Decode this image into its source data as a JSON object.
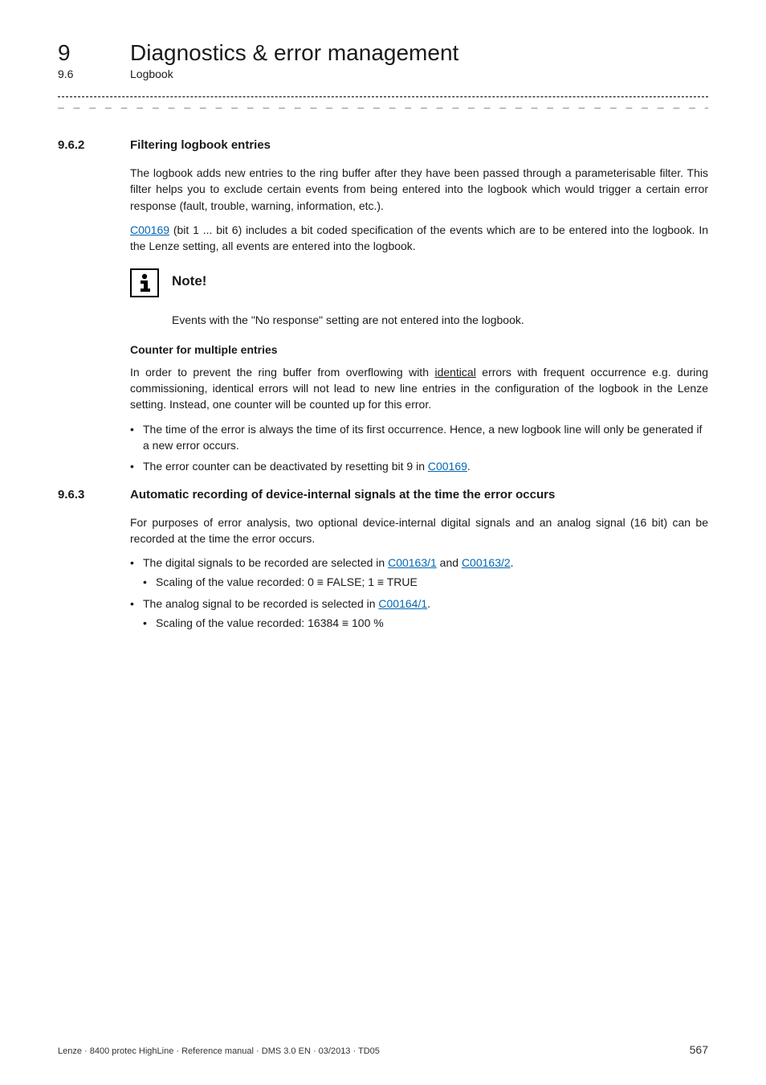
{
  "header": {
    "chapter_number": "9",
    "chapter_title": "Diagnostics & error management",
    "section_number": "9.6",
    "section_title": "Logbook"
  },
  "subsection1": {
    "number": "9.6.2",
    "title": "Filtering logbook entries",
    "para1": "The logbook adds new entries to the ring buffer after they have been passed through a parameterisable filter. This filter helps you to exclude certain events from being entered into the logbook which would trigger a certain error response (fault, trouble, warning, information, etc.).",
    "para2a": "C00169",
    "para2b": " (bit 1 ... bit 6) includes a bit coded specification of the events which are to be entered into the logbook. In the Lenze setting, all events are entered into the logbook.",
    "note_title": "Note!",
    "note_text": "Events with the \"No response\" setting are not entered into the logbook.",
    "counter_heading": "Counter for multiple entries",
    "counter_para_a": "In order to prevent the ring buffer from overflowing with ",
    "counter_para_underline": "identical",
    "counter_para_b": " errors with frequent occurrence e.g. during commissioning, identical errors will not lead to new line entries in the configuration of the logbook in the Lenze setting. Instead, one counter will be counted up for this error.",
    "bullet1": "The time of the error is always the time of its first occurrence. Hence, a new logbook line will only be generated if a new error occurs.",
    "bullet2a": "The error counter can be deactivated by resetting bit 9 in ",
    "bullet2_link": "C00169",
    "bullet2b": "."
  },
  "subsection2": {
    "number": "9.6.3",
    "title": "Automatic recording of device-internal signals at the time the error occurs",
    "para1": "For purposes of error analysis, two optional device-internal digital signals and an analog signal (16 bit) can be recorded at the time the error occurs.",
    "bullet1a": "The digital signals to be recorded are selected in ",
    "bullet1_link1": "C00163/1",
    "bullet1_mid": " and ",
    "bullet1_link2": "C00163/2",
    "bullet1b": ".",
    "sub1": "Scaling of the value recorded: 0 ≡ FALSE; 1 ≡ TRUE",
    "bullet2a": "The analog signal to be recorded is selected in ",
    "bullet2_link": "C00164/1",
    "bullet2b": ".",
    "sub2": "Scaling of the value recorded: 16384 ≡ 100 %"
  },
  "footer": {
    "left": "Lenze · 8400 protec HighLine · Reference manual · DMS 3.0 EN · 03/2013 · TD05",
    "page": "567"
  }
}
